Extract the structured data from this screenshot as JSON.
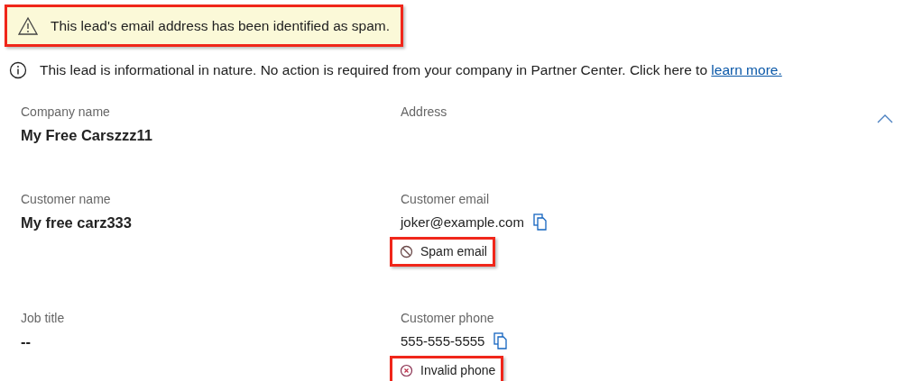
{
  "alert": {
    "text": "This lead's email address has been identified as spam.",
    "highlighted": true
  },
  "info": {
    "text": "This lead is informational in nature. No action is required from your company in Partner Center. Click here to",
    "link": "learn more."
  },
  "details": {
    "expanded": true,
    "rows": [
      {
        "left": {
          "label": "Company name",
          "value": "My Free Carszzz11"
        },
        "right": {
          "label": "Address"
        }
      },
      {
        "left": {
          "label": "Customer name",
          "value": "My free carz333"
        },
        "right": {
          "label": "Customer email",
          "value": "joker@example.com",
          "copyable": true,
          "badge": {
            "kind": "blocked",
            "text": "Spam email",
            "highlighted": true
          }
        }
      },
      {
        "left": {
          "label": "Job title",
          "value": "--"
        },
        "right": {
          "label": "Customer phone",
          "value": "555-555-5555",
          "copyable": true,
          "badge": {
            "kind": "invalid",
            "text": "Invalid phone",
            "highlighted": true
          }
        }
      }
    ]
  }
}
